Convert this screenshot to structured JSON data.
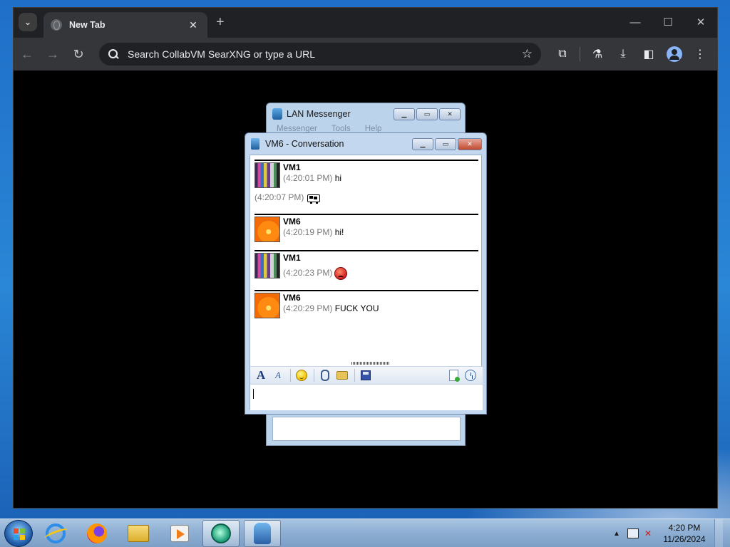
{
  "browser": {
    "tab_title": "New Tab",
    "tab_close": "✕",
    "new_tab": "+",
    "window_controls": {
      "minimize": "—",
      "maximize": "☐",
      "close": "✕"
    },
    "nav": {
      "back": "←",
      "forward": "→",
      "reload": "↻"
    },
    "omnibox_placeholder": "Search CollabVM SearXNG or type a URL",
    "toolbar_icons": [
      "bookmark-star-icon",
      "extensions-icon",
      "labs-icon",
      "download-icon",
      "side-panel-icon",
      "profile-icon",
      "menu-icon"
    ],
    "glyphs": {
      "star": "☆",
      "extensions": "⧉",
      "labs": "⚗",
      "download": "⤓",
      "side_panel": "◧",
      "menu": "⋮"
    }
  },
  "lan_messenger": {
    "title": "LAN Messenger",
    "menu": [
      "Messenger",
      "Tools",
      "Help"
    ]
  },
  "conversation": {
    "title": "VM6 - Conversation",
    "buttons": {
      "minimize": "▁",
      "maximize": "▭",
      "close": "✕"
    },
    "messages": [
      {
        "sender": "VM1",
        "avatar": "bottles",
        "lines": [
          {
            "time": "(4:20:01 PM)",
            "text": "hi"
          },
          {
            "time": "(4:20:07 PM)",
            "emoji": "cow-emoticon"
          }
        ]
      },
      {
        "sender": "VM6",
        "avatar": "flower",
        "lines": [
          {
            "time": "(4:20:19 PM)",
            "text": "hi!"
          }
        ]
      },
      {
        "sender": "VM1",
        "avatar": "bottles",
        "lines": [
          {
            "time": "(4:20:23 PM)",
            "emoji": "angry-emoticon"
          }
        ]
      },
      {
        "sender": "VM6",
        "avatar": "flower",
        "lines": [
          {
            "time": "(4:20:29 PM)",
            "text": "FUCK YOU"
          }
        ]
      }
    ],
    "format_bar": {
      "font_glyph": "A",
      "color_glyph": "A",
      "icons": [
        "font-icon",
        "font-color-icon",
        "smiley-icon",
        "attach-file-icon",
        "send-folder-icon",
        "save-icon",
        "history-doc-icon",
        "history-clock-icon"
      ]
    },
    "input_value": ""
  },
  "taskbar": {
    "pinned": [
      "internet-explorer-icon",
      "firefox-icon",
      "file-explorer-icon",
      "media-player-icon",
      "lan-messenger-app-icon",
      "lan-messenger-icon"
    ],
    "tray_up": "▲",
    "tray_volume": "✕",
    "clock_time": "4:20 PM",
    "clock_date": "11/26/2024"
  }
}
